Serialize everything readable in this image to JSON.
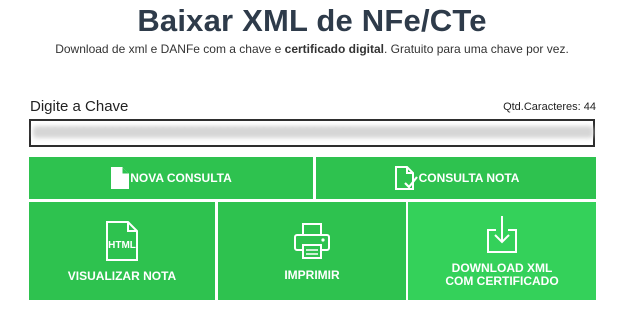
{
  "header": {
    "title": "Baixar XML de NFe/CTe",
    "subtitle_part1": "Download de xml e DANFe com a chave e ",
    "subtitle_bold": "certificado digital",
    "subtitle_part2": ". Gratuito para uma chave por vez."
  },
  "form": {
    "key_label": "Digite a Chave",
    "char_count": "Qtd.Caracteres: 44",
    "key_value": "••••••••••••••••••••••••••••••••••••••••••••"
  },
  "buttons": {
    "nova_consulta": "NOVA CONSULTA",
    "consulta_nota": "CONSULTA NOTA",
    "visualizar_nota": "VISUALIZAR NOTA",
    "imprimir": "IMPRIMIR",
    "download_line1": "DOWNLOAD XML",
    "download_line2": "COM CERTIFICADO",
    "html_icon_text": "HTML"
  },
  "icons": {
    "nova_consulta": "file-icon",
    "consulta_nota": "file-check-icon",
    "visualizar_nota": "html-file-icon",
    "imprimir": "printer-icon",
    "download": "download-icon"
  },
  "colors": {
    "button_green": "#2ec24f",
    "button_green_light": "#34d15a",
    "title": "#2e3b4a"
  }
}
